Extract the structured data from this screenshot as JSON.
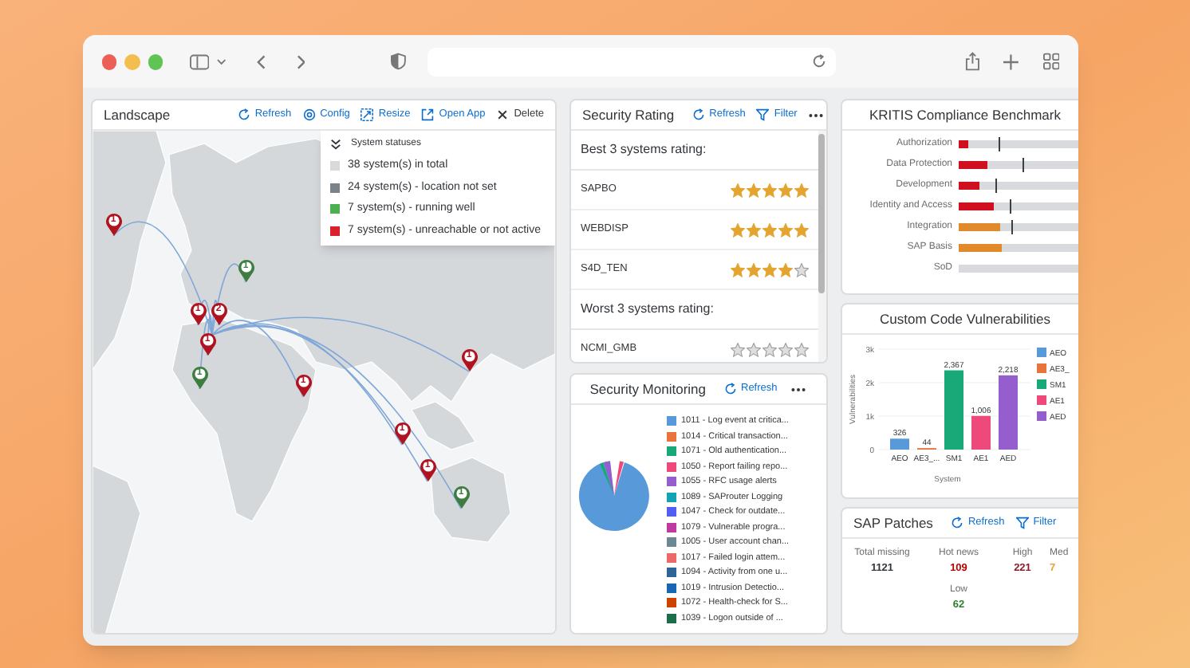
{
  "landscape": {
    "title": "Landscape",
    "actions": [
      {
        "label": "Refresh",
        "kind": "refresh"
      },
      {
        "label": "Config",
        "kind": "config"
      },
      {
        "label": "Resize",
        "kind": "resize"
      },
      {
        "label": "Open App",
        "kind": "open"
      },
      {
        "label": "Delete",
        "kind": "delete"
      }
    ],
    "legend": {
      "title": "System statuses",
      "items": [
        {
          "label": "38 system(s) in total",
          "color": "#d9d9d9"
        },
        {
          "label": "24 system(s) - location not set",
          "color": "#7b8289"
        },
        {
          "label": "7 system(s) - running well",
          "color": "#4caf50"
        },
        {
          "label": "7 system(s) - unreachable or not active",
          "color": "#d9202c"
        }
      ]
    },
    "pins": [
      {
        "label": "1",
        "color": "#b0121f"
      },
      {
        "label": "1",
        "color": "#3d7d3f"
      },
      {
        "label": "1",
        "color": "#b0121f"
      },
      {
        "label": "2",
        "color": "#b0121f"
      },
      {
        "label": "1",
        "color": "#b0121f"
      },
      {
        "label": "1",
        "color": "#3d7d3f"
      },
      {
        "label": "1",
        "color": "#b0121f"
      },
      {
        "label": "1",
        "color": "#b0121f"
      },
      {
        "label": "1",
        "color": "#b0121f"
      },
      {
        "label": "1",
        "color": "#b0121f"
      },
      {
        "label": "1",
        "color": "#3d7d3f"
      }
    ]
  },
  "security_rating": {
    "title": "Security Rating",
    "actions": [
      {
        "label": "Refresh",
        "kind": "refresh"
      },
      {
        "label": "Filter",
        "kind": "filter"
      }
    ],
    "sections": [
      {
        "heading": "Best 3 systems rating:",
        "rows": [
          {
            "name": "SAPBO",
            "stars": 5
          },
          {
            "name": "WEBDISP",
            "stars": 5
          },
          {
            "name": "S4D_TEN",
            "stars": 4
          }
        ]
      },
      {
        "heading": "Worst 3 systems rating:",
        "rows": [
          {
            "name": "NCMI_GMB",
            "stars": 0
          }
        ]
      }
    ]
  },
  "security_monitoring": {
    "title": "Security Monitoring",
    "actions": [
      {
        "label": "Refresh",
        "kind": "refresh"
      }
    ],
    "legend": [
      {
        "label": "1011 - Log event at critica...",
        "color": "#5899da"
      },
      {
        "label": "1014 - Critical transaction...",
        "color": "#e8743b"
      },
      {
        "label": "1071 - Old authentication...",
        "color": "#19a979"
      },
      {
        "label": "1050 - Report failing repo...",
        "color": "#ed4a7b"
      },
      {
        "label": "1055 - RFC usage alerts",
        "color": "#945ecf"
      },
      {
        "label": "1089 - SAProuter Logging",
        "color": "#13a4b4"
      },
      {
        "label": "1047 - Check for outdate...",
        "color": "#525df4"
      },
      {
        "label": "1079 - Vulnerable progra...",
        "color": "#bf399e"
      },
      {
        "label": "1005 - User account chan...",
        "color": "#6c8893"
      },
      {
        "label": "1017 - Failed login attem...",
        "color": "#ee6868"
      },
      {
        "label": "1094 - Activity from one u...",
        "color": "#2f6497"
      },
      {
        "label": "1019 - Intrusion Detectio...",
        "color": "#1866b4"
      },
      {
        "label": "1072 - Health-check for S...",
        "color": "#cc4300"
      },
      {
        "label": "1039 - Logon outside of ...",
        "color": "#1e6d4a"
      }
    ]
  },
  "kritis": {
    "title": "KRITIS Compliance Benchmark",
    "rows": [
      {
        "label": "Authorization",
        "level": 0.08,
        "color": "#d0101e",
        "target": {
          "level": 0.31
        }
      },
      {
        "label": "Data Protection",
        "level": 0.23,
        "color": "#d0101e",
        "target": {
          "level": 0.5
        }
      },
      {
        "label": "Development",
        "level": 0.16,
        "color": "#d0101e",
        "target": {
          "level": 0.29
        }
      },
      {
        "label": "Identity and Access",
        "level": 0.28,
        "color": "#d0101e",
        "target": {
          "level": 0.4
        }
      },
      {
        "label": "Integration",
        "level": 0.33,
        "color": "#e08a2c",
        "target": {
          "level": 0.41
        }
      },
      {
        "label": "SAP Basis",
        "level": 0.34,
        "color": "#e08a2c"
      },
      {
        "label": "SoD"
      }
    ]
  },
  "custom_code": {
    "title": "Custom Code Vulnerabilities",
    "chart_data": {
      "type": "bar",
      "xlabel": "System",
      "ylabel": "Vulnerabilities",
      "categories": [
        "AEO",
        "AE3_...",
        "SM1",
        "AE1",
        "AED"
      ],
      "stacked": true,
      "ylim": [
        0,
        3000
      ],
      "yticks": [
        {
          "value": 0,
          "label": "0"
        },
        {
          "value": 1000,
          "label": "1k"
        },
        {
          "value": 2000,
          "label": "2k"
        },
        {
          "value": 3000,
          "label": "3k"
        }
      ],
      "value_labels": [
        "326",
        "44",
        "2,367",
        "1,006",
        "2,218"
      ],
      "legend": "right",
      "series": [
        {
          "name": "AEO",
          "color": "#5899da",
          "values": [
            326,
            null,
            null,
            null,
            null
          ]
        },
        {
          "name": "AE3_",
          "color": "#e8743b",
          "values": [
            null,
            44,
            null,
            null,
            null
          ]
        },
        {
          "name": "SM1",
          "color": "#19a979",
          "values": [
            null,
            null,
            2367,
            null,
            null
          ]
        },
        {
          "name": "AE1",
          "color": "#ed4a7b",
          "values": [
            null,
            null,
            null,
            1006,
            null
          ]
        },
        {
          "name": "AED",
          "color": "#945ecf",
          "values": [
            null,
            null,
            null,
            null,
            2218
          ]
        }
      ]
    }
  },
  "sap_patches": {
    "title": "SAP Patches",
    "actions": [
      {
        "label": "Refresh",
        "kind": "refresh"
      },
      {
        "label": "Filter",
        "kind": "filter"
      }
    ],
    "stats": [
      {
        "label": "Total missing",
        "value": "1121",
        "color": "#32363a"
      },
      {
        "label": "Hot news",
        "value": "109",
        "color": "#bb0000"
      },
      {
        "label": "High",
        "value": "221",
        "color": "#8a1a2a"
      },
      {
        "label": "Med",
        "value": "7",
        "color": "#e9a23b"
      },
      {
        "label": "Low",
        "value": "62",
        "color": "#2b7d2b"
      }
    ]
  }
}
